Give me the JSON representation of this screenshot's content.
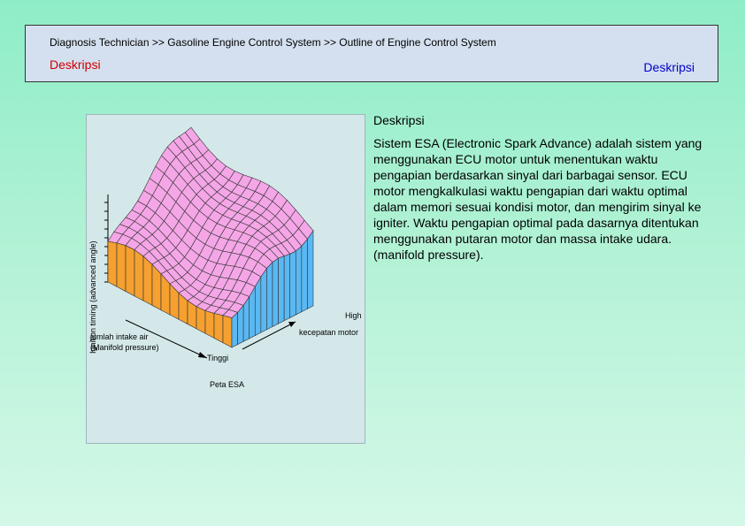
{
  "header": {
    "breadcrumb": "Diagnosis Technician >> Gasoline Engine Control System  >> Outline of Engine Control System",
    "section_left": "Deskripsi",
    "section_right": "Deskripsi"
  },
  "figure": {
    "y_axis_label": "Ignition timing (advanced angle)",
    "high_label": "High",
    "speed_label": "kecepatan motor",
    "intake_label_line1": "jumlah intake air",
    "intake_label_line2": "(Manifold pressure)",
    "low_label": "Tinggi",
    "caption": "Peta ESA",
    "colors": {
      "surface": "#f4a6e6",
      "left_wall": "#f5a030",
      "right_wall": "#5ab8f2",
      "panel": "#d4e8ea"
    }
  },
  "description": {
    "title": "Deskripsi",
    "body": "Sistem ESA (Electronic Spark Advance) adalah sistem yang menggunakan ECU motor untuk menentukan waktu pengapian berdasarkan sinyal dari barbagai sensor. ECU motor mengkalkulasi waktu pengapian dari waktu optimal dalam memori sesuai kondisi motor, dan mengirim sinyal ke igniter. Waktu pengapian optimal pada dasarnya ditentukan menggunakan putaran motor dan massa intake udara.(manifold pressure)."
  }
}
